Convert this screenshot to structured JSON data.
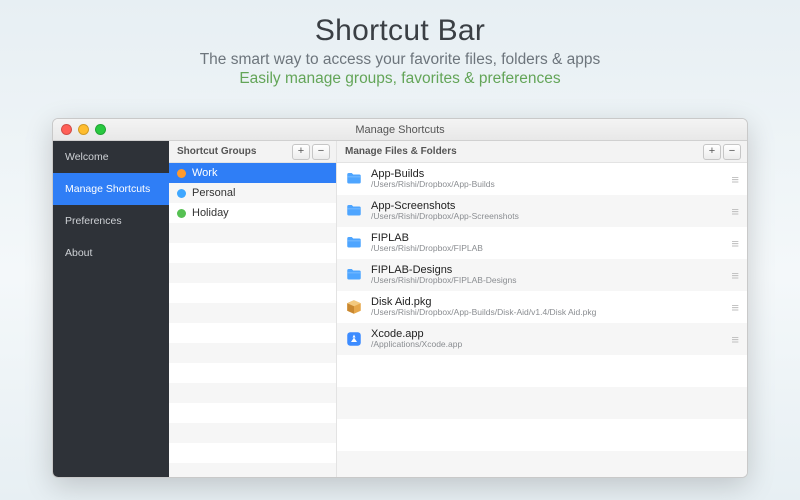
{
  "hero": {
    "title": "Shortcut Bar",
    "subtitle": "The smart way to access your favorite files, folders & apps",
    "tagline": "Easily manage groups, favorites & preferences"
  },
  "window": {
    "title": "Manage Shortcuts"
  },
  "sidebar": {
    "items": [
      {
        "label": "Welcome"
      },
      {
        "label": "Manage Shortcuts"
      },
      {
        "label": "Preferences"
      },
      {
        "label": "About"
      }
    ],
    "active_index": 1
  },
  "groups_pane": {
    "header": "Shortcut Groups",
    "add_label": "+",
    "remove_label": "−",
    "items": [
      {
        "label": "Work",
        "color": "#ff9a2e"
      },
      {
        "label": "Personal",
        "color": "#3fa7ff"
      },
      {
        "label": "Holiday",
        "color": "#56c153"
      }
    ],
    "selected_index": 0,
    "blank_rows": 13
  },
  "files_pane": {
    "header": "Manage Files & Folders",
    "add_label": "+",
    "remove_label": "−",
    "items": [
      {
        "name": "App-Builds",
        "path": "/Users/Rishi/Dropbox/App-Builds",
        "icon": "folder"
      },
      {
        "name": "App-Screenshots",
        "path": "/Users/Rishi/Dropbox/App-Screenshots",
        "icon": "folder"
      },
      {
        "name": "FIPLAB",
        "path": "/Users/Rishi/Dropbox/FIPLAB",
        "icon": "folder"
      },
      {
        "name": "FIPLAB-Designs",
        "path": "/Users/Rishi/Dropbox/FIPLAB-Designs",
        "icon": "folder"
      },
      {
        "name": "Disk Aid.pkg",
        "path": "/Users/Rishi/Dropbox/App-Builds/Disk-Aid/v1.4/Disk Aid.pkg",
        "icon": "pkg"
      },
      {
        "name": "Xcode.app",
        "path": "/Applications/Xcode.app",
        "icon": "app"
      }
    ],
    "blank_rows": 4
  }
}
